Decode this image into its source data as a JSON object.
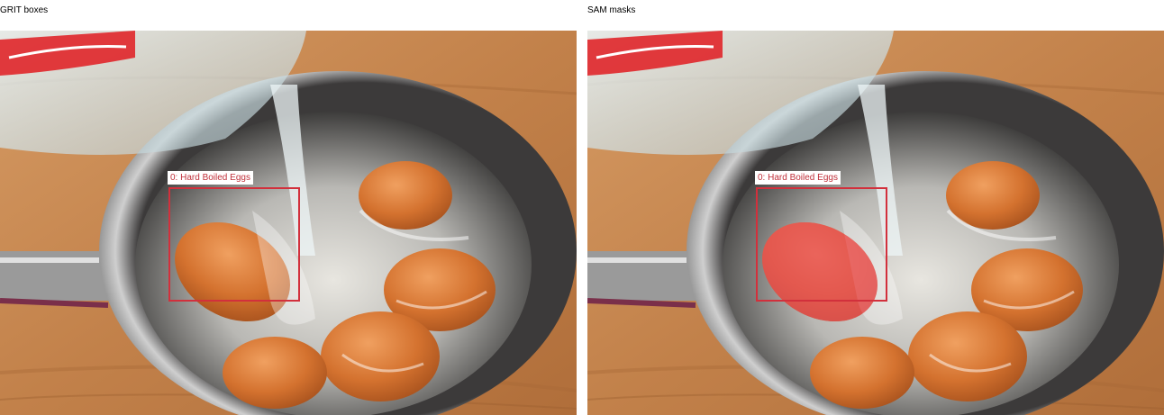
{
  "panels": {
    "left": {
      "title": "GRIT boxes"
    },
    "right": {
      "title": "SAM masks"
    }
  },
  "detections": [
    {
      "label": "0: Hard Boiled Eggs"
    }
  ],
  "colors": {
    "box": "#d2303c",
    "mask": "#e8505a",
    "board": "#c98a55",
    "egg": "#d8773a"
  },
  "scene_icons": [
    "wooden-board",
    "steel-pot",
    "pot-handle",
    "measuring-cup",
    "water-stream",
    "eggs"
  ]
}
